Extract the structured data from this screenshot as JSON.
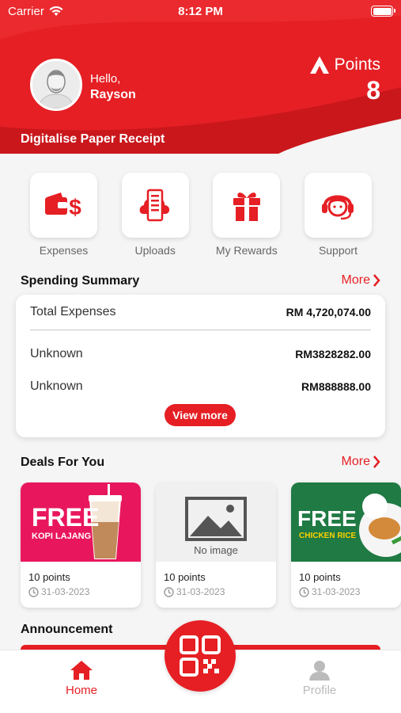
{
  "status_bar": {
    "carrier": "Carrier",
    "time": "8:12 PM"
  },
  "header": {
    "greeting": "Hello,",
    "user_name": "Rayson",
    "points_label": "Points",
    "points_value": "8",
    "banner_text": "Digitalise Paper Receipt"
  },
  "actions": [
    {
      "label": "Expenses",
      "icon": "wallet-dollar-icon"
    },
    {
      "label": "Uploads",
      "icon": "cloud-receipt-icon"
    },
    {
      "label": "My Rewards",
      "icon": "gift-icon"
    },
    {
      "label": "Support",
      "icon": "headset-agent-icon"
    }
  ],
  "spending": {
    "title": "Spending Summary",
    "more_label": "More",
    "total_label": "Total Expenses",
    "total_value": "RM 4,720,074.00",
    "rows": [
      {
        "label": "Unknown",
        "value": "RM3828282.00"
      },
      {
        "label": "Unknown",
        "value": "RM888888.00"
      }
    ],
    "view_more_label": "View more"
  },
  "deals": {
    "title": "Deals For You",
    "more_label": "More",
    "items": [
      {
        "image_text": "FREE",
        "image_subtext": "KOPI LAJANG",
        "points": "10 points",
        "date": "31-03-2023"
      },
      {
        "image_text": "No image",
        "points": "10 points",
        "date": "31-03-2023"
      },
      {
        "image_text": "FREE",
        "image_subtext": "CHICKEN RICE",
        "points": "10 points",
        "date": "31-03-2023"
      }
    ]
  },
  "announcement": {
    "title": "Announcement"
  },
  "tabbar": {
    "home_label": "Home",
    "profile_label": "Profile"
  },
  "colors": {
    "brand": "#e51f24",
    "muted": "#999999"
  }
}
